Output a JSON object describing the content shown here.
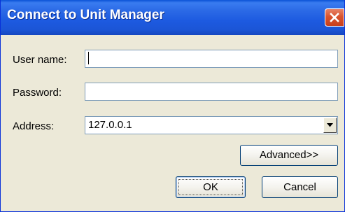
{
  "window": {
    "title": "Connect to Unit Manager",
    "close_icon": "close-icon"
  },
  "form": {
    "username_label": "User name:",
    "username_value": "",
    "password_label": "Password:",
    "password_value": "",
    "address_label": "Address:",
    "address_value": "127.0.0.1",
    "address_arrow_icon": "chevron-down-icon"
  },
  "buttons": {
    "advanced_label": "Advanced>>",
    "ok_label": "OK",
    "cancel_label": "Cancel"
  },
  "colors": {
    "titlebar": "#2b6ae6",
    "close_button": "#d9532e",
    "dialog_face": "#ece9d8",
    "input_border": "#7f9db9"
  }
}
